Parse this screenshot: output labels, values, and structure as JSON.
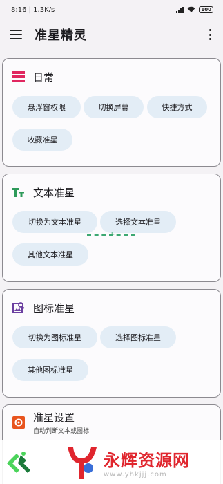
{
  "status_bar": {
    "time": "8:16 | 1.3K/s",
    "battery": "100"
  },
  "app_bar": {
    "title": "准星精灵"
  },
  "sections": [
    {
      "title": "日常",
      "icon": "daily-list-icon",
      "chips": [
        "悬浮窗权限",
        "切换屏幕",
        "快捷方式",
        "收藏准星"
      ]
    },
    {
      "title": "文本准星",
      "icon": "text-format-icon",
      "chips": [
        "切换为文本准星",
        "选择文本准星",
        "其他文本准星"
      ]
    },
    {
      "title": "图标准星",
      "icon": "image-search-icon",
      "chips": [
        "切换为图标准星",
        "选择图标准星",
        "其他图标准星"
      ]
    },
    {
      "title": "准星设置",
      "subtitle": "自动判断文本或图标",
      "icon": "settings-gear-icon",
      "chips": []
    }
  ],
  "colors": {
    "accent_red": "#e0265f",
    "accent_green": "#2e9a5a",
    "accent_purple": "#6b3fa0",
    "accent_orange": "#e8541e",
    "chip_bg": "#e3edf6"
  },
  "watermark": {
    "title": "永辉资源网",
    "url": "www.yhkjjj.com"
  }
}
